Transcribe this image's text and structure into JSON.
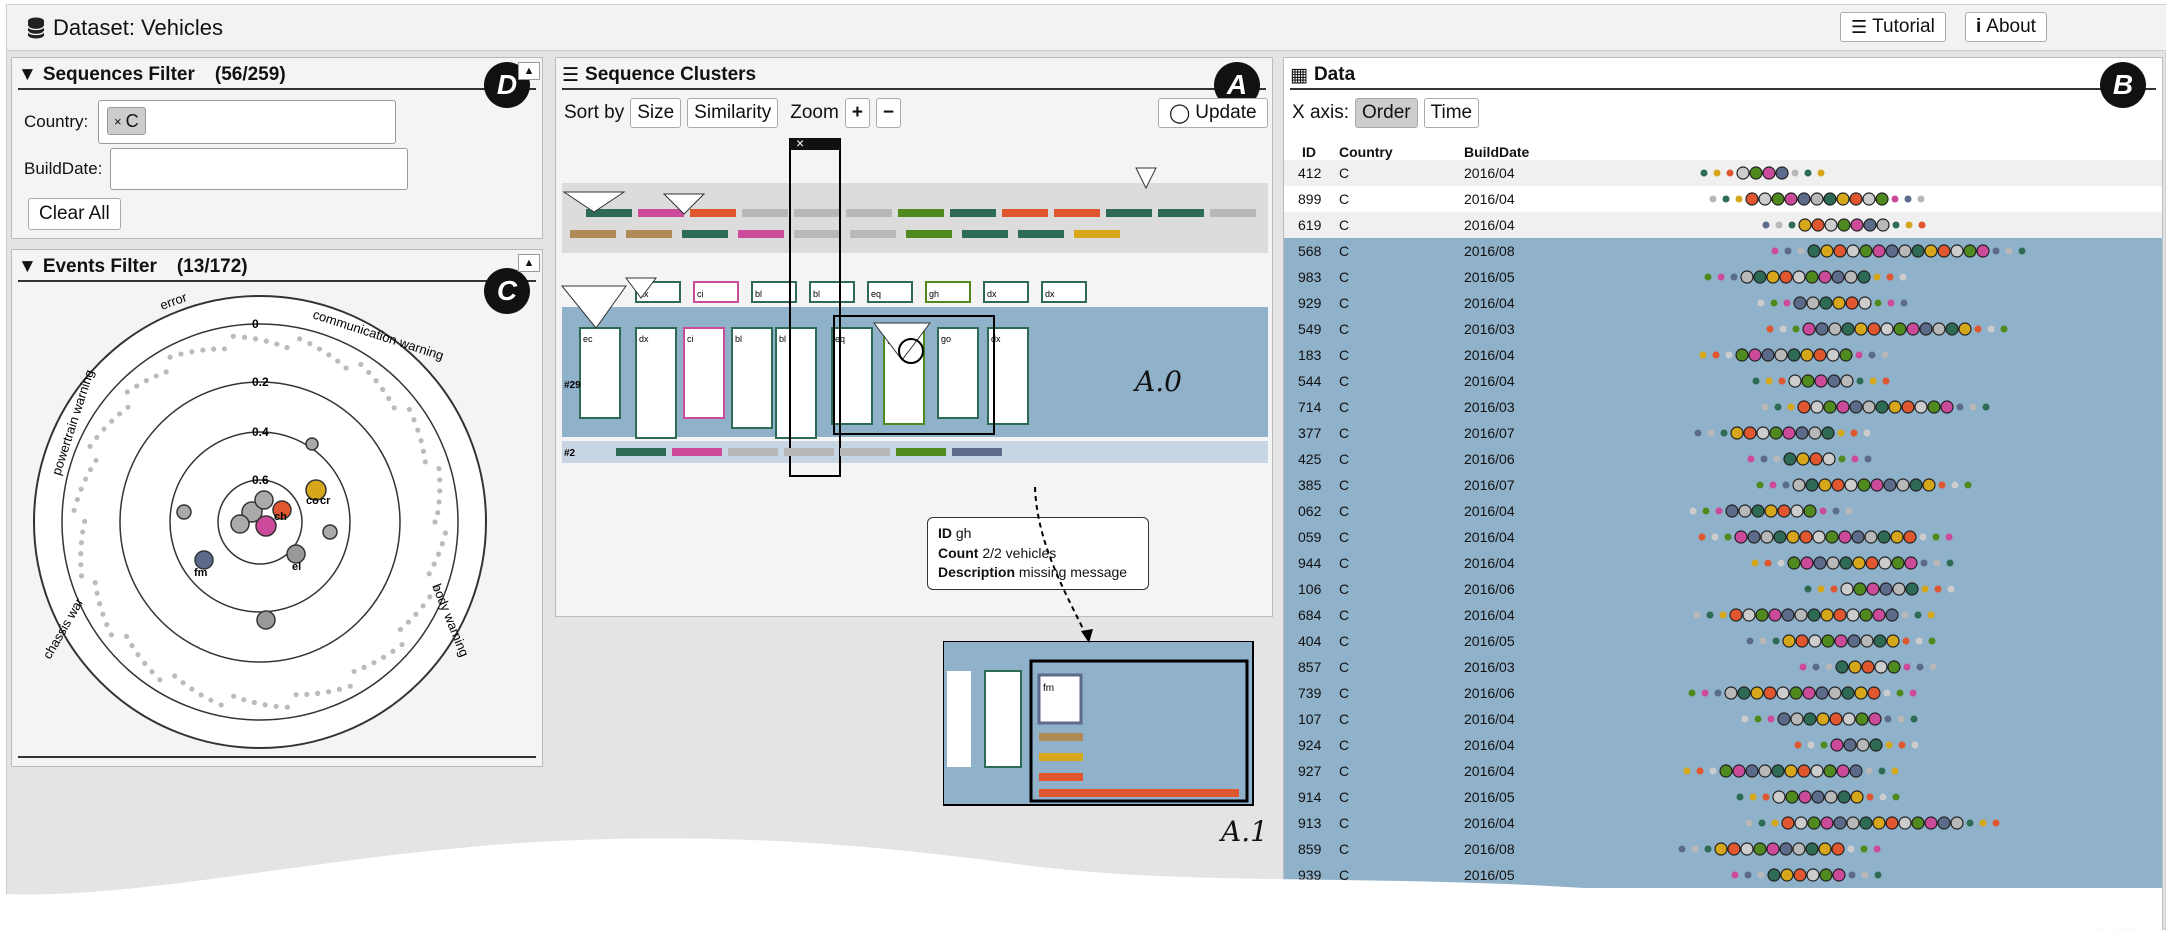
{
  "app": {
    "title": "Dataset: Vehicles"
  },
  "topbar": {
    "tutorial_label": "Tutorial",
    "about_label": "About"
  },
  "seq_filter": {
    "title": "Sequences Filter",
    "count": "(56/259)",
    "badge": "D",
    "country_label": "Country:",
    "country_chip": "C",
    "builddate_label": "BuildDate:",
    "builddate_value": "",
    "clear_label": "Clear All"
  },
  "events_filter": {
    "title": "Events Filter",
    "count": "(13/172)",
    "badge": "C",
    "ring_labels": [
      "error",
      "communication warning",
      "powertrain warning",
      "chassis war",
      "body warning"
    ],
    "radius_labels": [
      "0",
      "0.2",
      "0.4",
      "0.6"
    ],
    "node_labels": [
      "fm",
      "ch",
      "co",
      "cr",
      "el"
    ]
  },
  "clusters": {
    "title": "Sequence Clusters",
    "badge": "A",
    "sort_label": "Sort by",
    "size_label": "Size",
    "similarity_label": "Similarity",
    "zoom_label": "Zoom",
    "zoom_in": "+",
    "zoom_out": "−",
    "update_label": "Update",
    "col_close": "×",
    "row_labels": [
      "#29",
      "#2"
    ],
    "block_labels_row3": [
      "dx",
      "ci",
      "bl",
      "bl",
      "eq",
      "gh",
      "dx",
      "dx"
    ],
    "block_labels_row4": [
      "ec",
      "dx",
      "ci",
      "bl",
      "bl",
      "eq",
      "gh",
      "go",
      "dx"
    ],
    "annot_a0": "A.0",
    "annot_a1": "A.1",
    "minimap_label": "fm",
    "tooltip": {
      "id_key": "ID",
      "id_val": "gh",
      "count_key": "Count",
      "count_val": "2/2 vehicles",
      "desc_key": "Description",
      "desc_val": "missing message"
    }
  },
  "data_panel": {
    "title": "Data",
    "badge": "B",
    "xaxis_label": "X axis:",
    "order_label": "Order",
    "time_label": "Time",
    "headers": {
      "id": "ID",
      "country": "Country",
      "builddate": "BuildDate"
    },
    "rows": [
      {
        "id": "412",
        "country": "C",
        "date": "2016/04"
      },
      {
        "id": "899",
        "country": "C",
        "date": "2016/04"
      },
      {
        "id": "619",
        "country": "C",
        "date": "2016/04"
      },
      {
        "id": "568",
        "country": "C",
        "date": "2016/08"
      },
      {
        "id": "983",
        "country": "C",
        "date": "2016/05"
      },
      {
        "id": "929",
        "country": "C",
        "date": "2016/04"
      },
      {
        "id": "549",
        "country": "C",
        "date": "2016/03"
      },
      {
        "id": "183",
        "country": "C",
        "date": "2016/04"
      },
      {
        "id": "544",
        "country": "C",
        "date": "2016/04"
      },
      {
        "id": "714",
        "country": "C",
        "date": "2016/03"
      },
      {
        "id": "377",
        "country": "C",
        "date": "2016/07"
      },
      {
        "id": "425",
        "country": "C",
        "date": "2016/06"
      },
      {
        "id": "385",
        "country": "C",
        "date": "2016/07"
      },
      {
        "id": "062",
        "country": "C",
        "date": "2016/04"
      },
      {
        "id": "059",
        "country": "C",
        "date": "2016/04"
      },
      {
        "id": "944",
        "country": "C",
        "date": "2016/04"
      },
      {
        "id": "106",
        "country": "C",
        "date": "2016/06"
      },
      {
        "id": "684",
        "country": "C",
        "date": "2016/04"
      },
      {
        "id": "404",
        "country": "C",
        "date": "2016/05"
      },
      {
        "id": "857",
        "country": "C",
        "date": "2016/03"
      },
      {
        "id": "739",
        "country": "C",
        "date": "2016/06"
      },
      {
        "id": "107",
        "country": "C",
        "date": "2016/04"
      },
      {
        "id": "924",
        "country": "C",
        "date": "2016/04"
      },
      {
        "id": "927",
        "country": "C",
        "date": "2016/04"
      },
      {
        "id": "914",
        "country": "C",
        "date": "2016/05"
      },
      {
        "id": "913",
        "country": "C",
        "date": "2016/04"
      },
      {
        "id": "859",
        "country": "C",
        "date": "2016/08"
      },
      {
        "id": "939",
        "country": "C",
        "date": "2016/05"
      }
    ]
  },
  "colors": {
    "dark_green": "#2e6b55",
    "pink": "#cc4a9a",
    "red": "#e0562f",
    "gray": "#b8b8b8",
    "green": "#4f8a1e",
    "brown": "#b08a55",
    "yellow": "#d6a71a",
    "slate": "#5c6b8a",
    "selection_blue": "#8fb1c9"
  }
}
